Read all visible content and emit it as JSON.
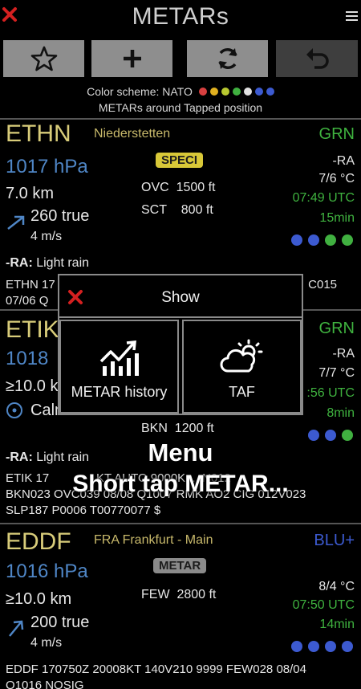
{
  "app": {
    "title": "METARs"
  },
  "header": {
    "color_scheme_label": "Color scheme: NATO",
    "scheme_colors": [
      "#d84040",
      "#e0b020",
      "#b8c830",
      "#40b040",
      "#e0e0e0",
      "#3c5ad0",
      "#3c5ad0"
    ],
    "around_label": "METARs around Tapped position"
  },
  "stations": [
    {
      "icao": "ETHN",
      "name": "Niederstetten",
      "color_code": "GRN",
      "color_code_color": "#3fb23f",
      "pressure": "1017 hPa",
      "visibility": "7.0 km",
      "wind_dir": "260 true",
      "wind_speed": "4 m/s",
      "badge": "SPECI",
      "clouds": [
        {
          "cover": "OVC",
          "height": "1500 ft"
        },
        {
          "cover": "SCT",
          "height": "800 ft"
        }
      ],
      "weather": "-RA",
      "temp": "7/6 °C",
      "time": "07:49 UTC",
      "age": "15min",
      "wx_code": "-RA:",
      "wx_text": " Light rain",
      "raw_line1": "ETHN 17",
      "raw_line1_tail": "C015",
      "raw_line2": "07/06 Q",
      "status_dots": [
        "#3c5ad0",
        "#3c5ad0",
        "#40b040",
        "#40b040"
      ]
    },
    {
      "icao": "ETIK",
      "color_code": "GRN",
      "color_code_color": "#3fb23f",
      "pressure": "1018",
      "visibility": "≥10.0 k",
      "wind": "Calm",
      "clouds": [
        {
          "cover": "BKN",
          "height": "1200 ft"
        }
      ],
      "weather": "-RA",
      "temp": "7/7 °C",
      "time": ":56 UTC",
      "age": "8min",
      "wx_code": "-RA:",
      "wx_text": " Light rain",
      "raw_line1": "ETIK 17",
      "raw_line1_tail": "KT AUTO 9000K  ...  N012",
      "raw_line2": "BKN023 OVC039 08/08 Q1007 RMK AO2 CIG 012V023",
      "raw_line3": "SLP187 P0006 T00770077 $",
      "status_dots": [
        "#3c5ad0",
        "#3c5ad0",
        "#40b040"
      ]
    },
    {
      "icao": "EDDF",
      "name": "FRA Frankfurt - Main",
      "color_code": "BLU+",
      "color_code_color": "#3c5ad0",
      "pressure": "1016 hPa",
      "visibility": "≥10.0 km",
      "wind_dir": "200 true",
      "wind_speed": "4 m/s",
      "badge": "METAR",
      "clouds": [
        {
          "cover": "FEW",
          "height": "2800 ft"
        }
      ],
      "temp": "8/4 °C",
      "time": "07:50 UTC",
      "age": "14min",
      "raw_line1": "EDDF 170750Z 20008KT 140V210 9999 FEW028 08/04",
      "raw_line2": "Q1016 NOSIG",
      "status_dots": [
        "#3c5ad0",
        "#3c5ad0",
        "#3c5ad0",
        "#3c5ad0"
      ]
    }
  ],
  "popup": {
    "title": "Show",
    "history_label": "METAR history",
    "taf_label": "TAF"
  },
  "overlay": {
    "line1": "Menu",
    "line2": "Short tap METAR..."
  },
  "icons": {
    "close": "close-x-icon",
    "menu": "hamburger-menu-icon",
    "favorite": "star-icon",
    "add": "plus-icon",
    "refresh": "refresh-icon",
    "back": "undo-icon",
    "history": "chart-icon",
    "taf": "cloud-sun-icon"
  }
}
